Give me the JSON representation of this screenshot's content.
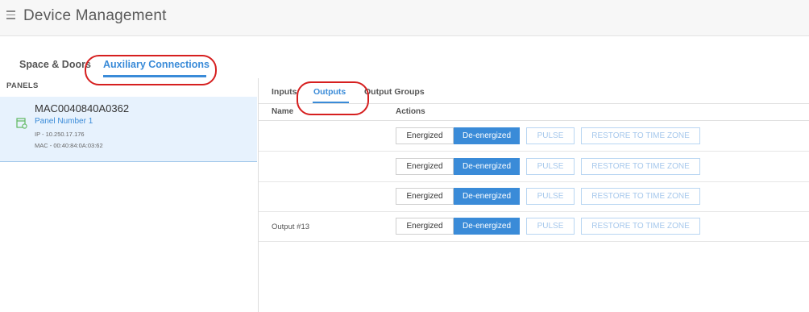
{
  "app": {
    "title": "Device Management"
  },
  "main_tabs": [
    {
      "label": "Space & Doors"
    },
    {
      "label": "Auxiliary Connections"
    }
  ],
  "left": {
    "heading": "PANELS",
    "panel": {
      "name": "MAC0040840A0362",
      "subtitle": "Panel Number 1",
      "ip": "IP - 10.250.17.176",
      "mac": "MAC - 00:40:84:0A:03:62"
    }
  },
  "sub_tabs": [
    {
      "label": "Inputs"
    },
    {
      "label": "Outputs"
    },
    {
      "label": "Output Groups"
    }
  ],
  "table": {
    "col_name": "Name",
    "col_actions": "Actions",
    "rows": [
      {
        "name": "",
        "energized": "Energized",
        "deenergized": "De-energized",
        "pulse": "PULSE",
        "restore": "RESTORE TO TIME ZONE"
      },
      {
        "name": "",
        "energized": "Energized",
        "deenergized": "De-energized",
        "pulse": "PULSE",
        "restore": "RESTORE TO TIME ZONE"
      },
      {
        "name": "",
        "energized": "Energized",
        "deenergized": "De-energized",
        "pulse": "PULSE",
        "restore": "RESTORE TO TIME ZONE"
      },
      {
        "name": "Output #13",
        "energized": "Energized",
        "deenergized": "De-energized",
        "pulse": "PULSE",
        "restore": "RESTORE TO TIME ZONE"
      }
    ]
  },
  "colors": {
    "accent": "#3a8bd8",
    "highlight_ring": "#d61f1f",
    "selected_bg": "#e7f2fd",
    "icon_green": "#5fb85f"
  },
  "icons": {
    "menu": "hamburger-icon",
    "panel": "panel-icon"
  }
}
